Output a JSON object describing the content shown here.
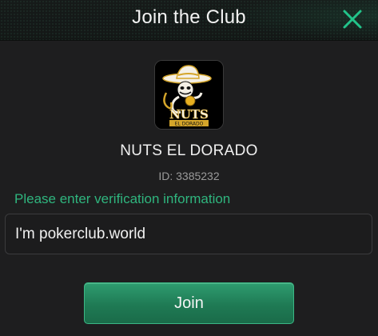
{
  "header": {
    "title": "Join the Club",
    "close_icon": "close-x-icon",
    "accent_color": "#22c48a"
  },
  "club": {
    "logo_icon": "nuts-el-dorado-logo",
    "logo_text": "NUTS",
    "logo_subtext": "EL DORADO",
    "name": "NUTS EL DORADO",
    "id_label": "ID: 3385232"
  },
  "form": {
    "prompt": "Please enter verification information",
    "prompt_color": "#2fb57e",
    "message_value": "I'm pokerclub.world"
  },
  "actions": {
    "join_label": "Join",
    "join_color": "#1f7a54"
  }
}
